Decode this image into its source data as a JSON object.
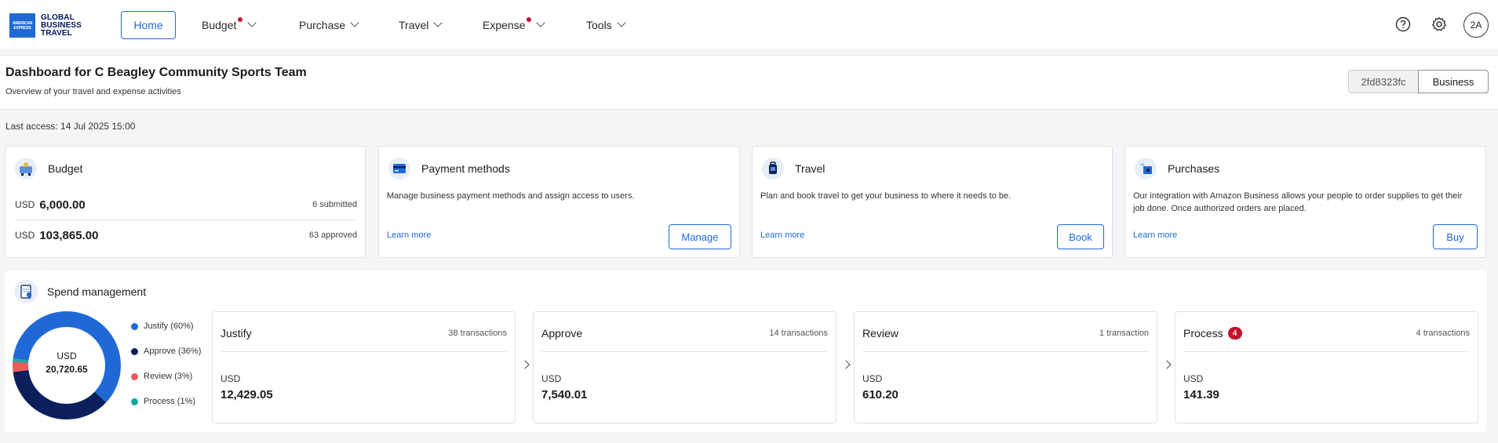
{
  "nav": {
    "logo": {
      "box_lines": [
        "AMERICAN",
        "EXPRESS"
      ],
      "text_lines": [
        "GLOBAL",
        "BUSINESS",
        "TRAVEL"
      ]
    },
    "items": [
      {
        "label": "Home"
      },
      {
        "label": "Budget",
        "has_dot": true
      },
      {
        "label": "Purchase"
      },
      {
        "label": "Travel"
      },
      {
        "label": "Expense",
        "has_dot": true
      },
      {
        "label": "Tools"
      }
    ],
    "help_icon": "help-circle-icon",
    "settings_icon": "gear-icon",
    "avatar_initials": "2A"
  },
  "header": {
    "title": "Dashboard for C Beagley Community Sports Team",
    "subtitle": "Overview of your travel and expense activities",
    "account_id": "2fd8323fc",
    "account_type": "Business"
  },
  "last_access": "Last access: 14 Jul 2025 15:00",
  "cards": {
    "budget": {
      "title": "Budget",
      "rows": [
        {
          "currency": "USD",
          "amount": "6,000.00",
          "meta": "6 submitted"
        },
        {
          "currency": "USD",
          "amount": "103,865.00",
          "meta": "63 approved"
        }
      ]
    },
    "payment": {
      "title": "Payment methods",
      "description": "Manage business payment methods and assign access to users.",
      "learn_more": "Learn more",
      "button": "Manage"
    },
    "travel": {
      "title": "Travel",
      "description": "Plan and book travel to get your business to where it needs to be.",
      "learn_more": "Learn more",
      "button": "Book"
    },
    "purchases": {
      "title": "Purchases",
      "description": "Our integration with Amazon Business allows your people to order supplies to get their job done. Once authorized orders are placed.",
      "learn_more": "Learn more",
      "button": "Buy"
    }
  },
  "spend": {
    "title": "Spend management",
    "total_currency": "USD",
    "total_amount": "20,720.65",
    "legend": [
      {
        "label": "Justify (60%)",
        "color": "#1f69d7",
        "percent": 60
      },
      {
        "label": "Approve (36%)",
        "color": "#0b1f5c",
        "percent": 36
      },
      {
        "label": "Review (3%)",
        "color": "#f05a5a",
        "percent": 3
      },
      {
        "label": "Process (1%)",
        "color": "#1aa79a",
        "percent": 1
      }
    ],
    "stages": [
      {
        "name": "Justify",
        "transactions": "38 transactions",
        "currency": "USD",
        "amount": "12,429.05",
        "badge": ""
      },
      {
        "name": "Approve",
        "transactions": "14 transactions",
        "currency": "USD",
        "amount": "7,540.01",
        "badge": ""
      },
      {
        "name": "Review",
        "transactions": "1 transaction",
        "currency": "USD",
        "amount": "610.20",
        "badge": ""
      },
      {
        "name": "Process",
        "transactions": "4 transactions",
        "currency": "USD",
        "amount": "141.39",
        "badge": "4"
      }
    ]
  }
}
